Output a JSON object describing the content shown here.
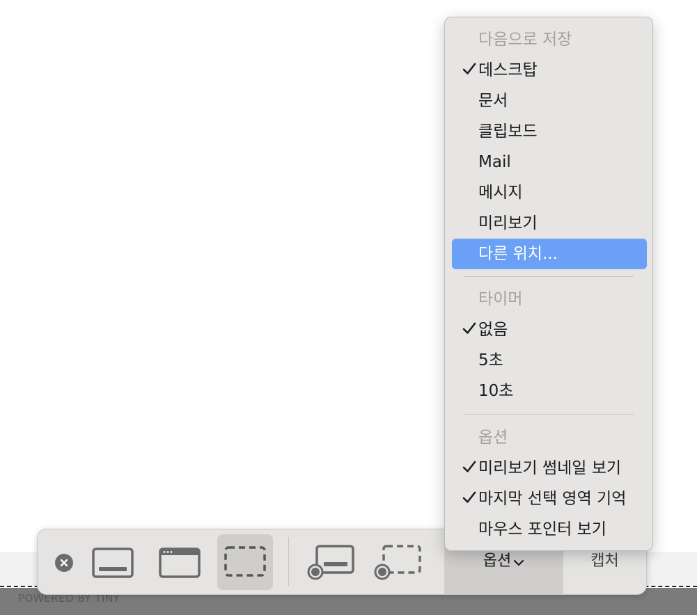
{
  "background": {
    "footer_text": "POWERED BY TINY"
  },
  "toolbar": {
    "close_icon": "close-icon",
    "buttons": [
      {
        "name": "capture-entire-screen-button",
        "icon": "screen-icon",
        "selected": false
      },
      {
        "name": "capture-window-button",
        "icon": "window-icon",
        "selected": false
      },
      {
        "name": "capture-selection-button",
        "icon": "selection-icon",
        "selected": true
      },
      {
        "name": "record-entire-screen-button",
        "icon": "record-screen-icon",
        "selected": false
      },
      {
        "name": "record-selection-button",
        "icon": "record-selection-icon",
        "selected": false
      }
    ],
    "options_label": "옵션",
    "capture_label": "캡처"
  },
  "menu": {
    "save_to": {
      "header": "다음으로 저장",
      "items": [
        {
          "label": "데스크탑",
          "checked": true
        },
        {
          "label": "문서",
          "checked": false
        },
        {
          "label": "클립보드",
          "checked": false
        },
        {
          "label": "Mail",
          "checked": false
        },
        {
          "label": "메시지",
          "checked": false
        },
        {
          "label": "미리보기",
          "checked": false
        },
        {
          "label": "다른 위치...",
          "checked": false,
          "highlighted": true
        }
      ]
    },
    "timer": {
      "header": "타이머",
      "items": [
        {
          "label": "없음",
          "checked": true
        },
        {
          "label": "5초",
          "checked": false
        },
        {
          "label": "10초",
          "checked": false
        }
      ]
    },
    "options": {
      "header": "옵션",
      "items": [
        {
          "label": "미리보기 썸네일 보기",
          "checked": true
        },
        {
          "label": "마지막 선택 영역 기억",
          "checked": true
        },
        {
          "label": "마우스 포인터 보기",
          "checked": false
        }
      ]
    }
  },
  "colors": {
    "highlight": "#6aa0f5",
    "menu_background": "#e6e5e4",
    "toolbar_background": "#e5e4e3"
  }
}
